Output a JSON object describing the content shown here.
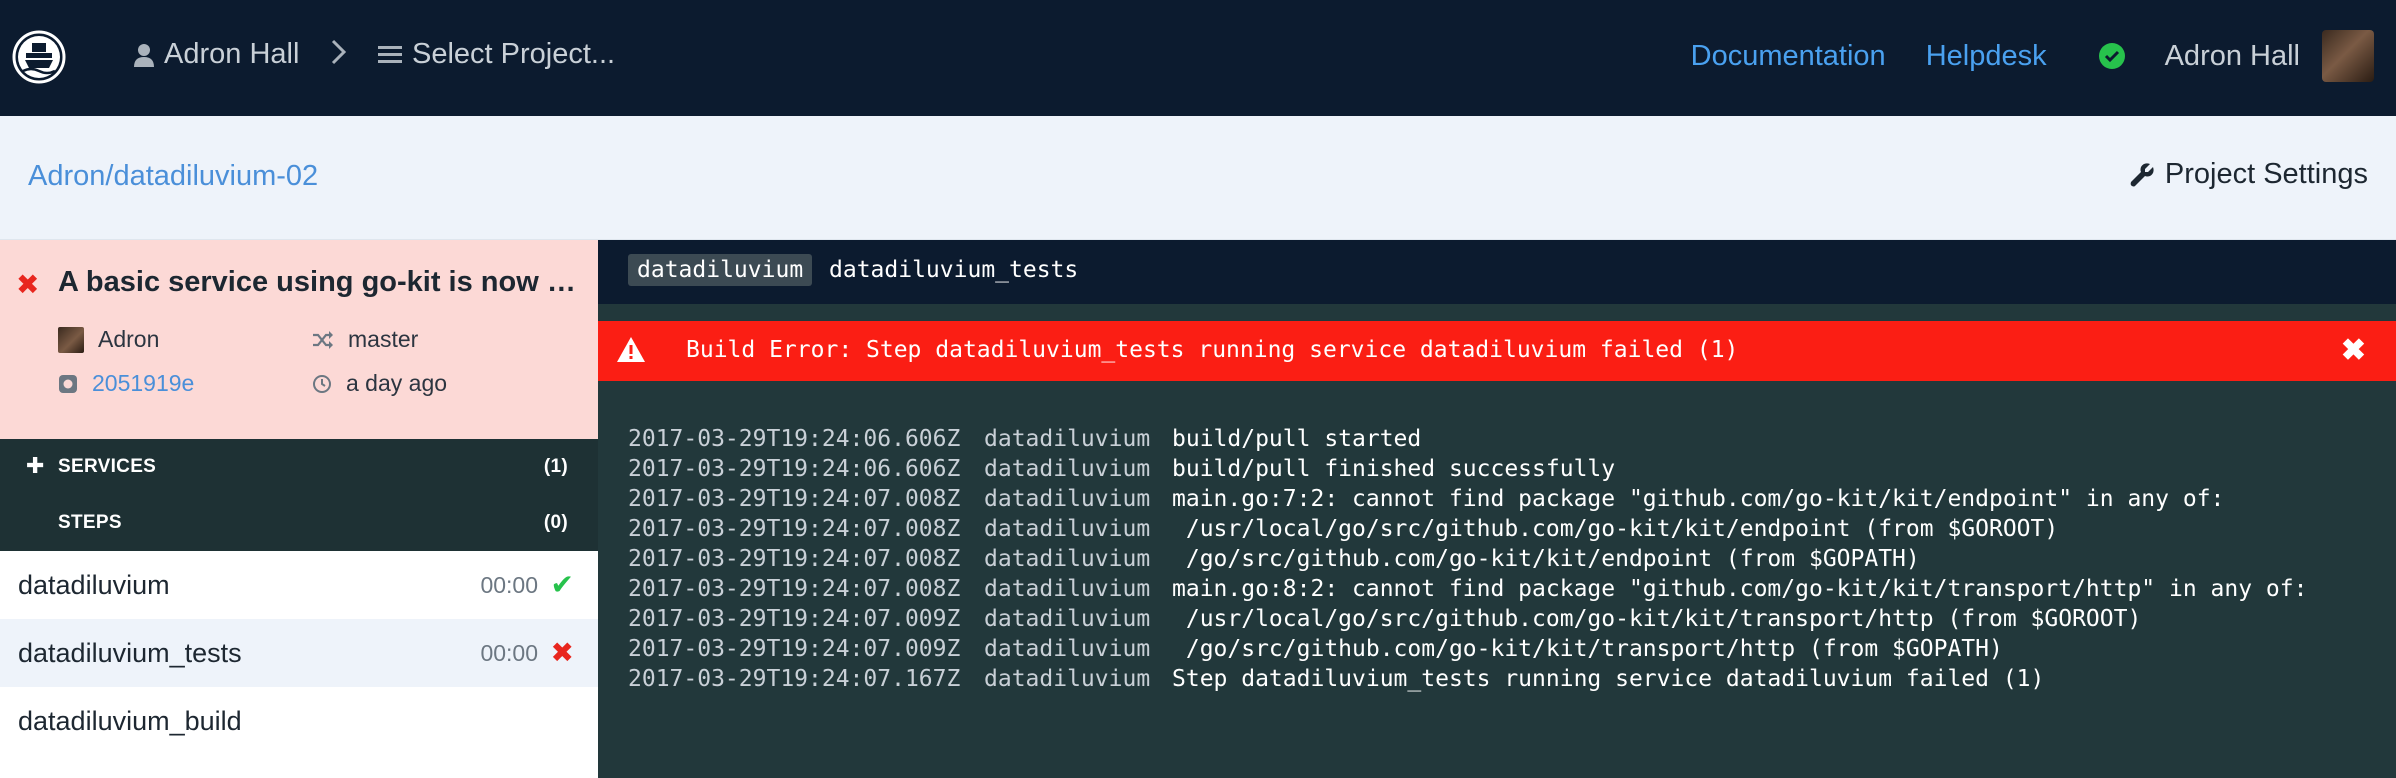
{
  "nav": {
    "user": "Adron Hall",
    "project_selector": "Select Project...",
    "links": [
      "Documentation",
      "Helpdesk"
    ],
    "account_name": "Adron Hall"
  },
  "project": {
    "path": "Adron/datadiluvium-02",
    "settings_label": "Project Settings"
  },
  "build": {
    "title": "A basic service using go-kit is now w...",
    "author": "Adron",
    "branch": "master",
    "commit": "2051919e",
    "time": "a day ago"
  },
  "sections": {
    "services": {
      "label": "SERVICES",
      "count": "(1)"
    },
    "steps": {
      "label": "STEPS",
      "count": "(0)"
    }
  },
  "steps": [
    {
      "name": "datadiluvium",
      "duration": "00:00",
      "status": "success"
    },
    {
      "name": "datadiluvium_tests",
      "duration": "00:00",
      "status": "failed"
    },
    {
      "name": "datadiluvium_build",
      "duration": "",
      "status": "none"
    }
  ],
  "log_panel": {
    "service_tag": "datadiluvium",
    "step_title": "datadiluvium_tests",
    "error_message": "Build Error: Step datadiluvium_tests running service datadiluvium failed (1)",
    "lines": [
      {
        "ts": "2017-03-29T19:24:06.606Z",
        "src": "datadiluvium",
        "msg": "build/pull started"
      },
      {
        "ts": "2017-03-29T19:24:06.606Z",
        "src": "datadiluvium",
        "msg": "build/pull finished successfully"
      },
      {
        "ts": "2017-03-29T19:24:07.008Z",
        "src": "datadiluvium",
        "msg": "main.go:7:2: cannot find package \"github.com/go-kit/kit/endpoint\" in any of:"
      },
      {
        "ts": "2017-03-29T19:24:07.008Z",
        "src": "datadiluvium",
        "msg": " /usr/local/go/src/github.com/go-kit/kit/endpoint (from $GOROOT)"
      },
      {
        "ts": "2017-03-29T19:24:07.008Z",
        "src": "datadiluvium",
        "msg": " /go/src/github.com/go-kit/kit/endpoint (from $GOPATH)"
      },
      {
        "ts": "2017-03-29T19:24:07.008Z",
        "src": "datadiluvium",
        "msg": "main.go:8:2: cannot find package \"github.com/go-kit/kit/transport/http\" in any of:"
      },
      {
        "ts": "2017-03-29T19:24:07.009Z",
        "src": "datadiluvium",
        "msg": " /usr/local/go/src/github.com/go-kit/kit/transport/http (from $GOROOT)"
      },
      {
        "ts": "2017-03-29T19:24:07.009Z",
        "src": "datadiluvium",
        "msg": " /go/src/github.com/go-kit/kit/transport/http (from $GOPATH)"
      },
      {
        "ts": "2017-03-29T19:24:07.167Z",
        "src": "datadiluvium",
        "msg": "Step datadiluvium_tests running service datadiluvium failed (1)"
      }
    ]
  },
  "colors": {
    "nav_bg": "#0c1b2f",
    "link": "#4aa1f0",
    "success": "#27c24c",
    "error": "#fb1e14",
    "log_bg": "#22383b",
    "failed_card_bg": "#fcd9d6"
  }
}
